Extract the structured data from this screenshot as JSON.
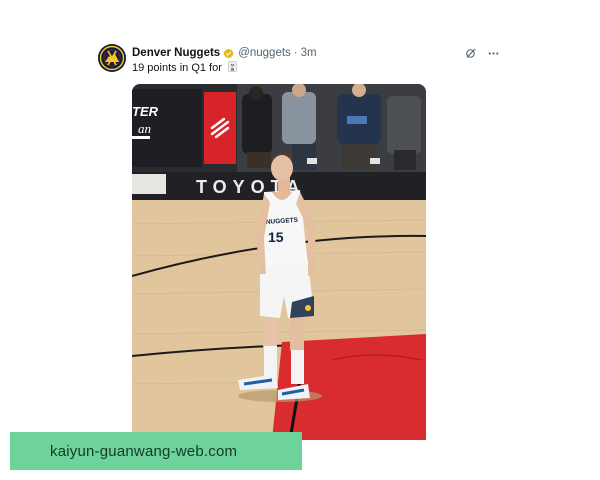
{
  "tweet": {
    "author_name": "Denver Nuggets",
    "handle": "@nuggets",
    "separator": "·",
    "time": "3m",
    "text": "19 points in Q1 for",
    "text_emoji_icon": "joker-card-emoji",
    "verified_icon": "gold-verified-badge-icon",
    "avatar_icon": "denver-nuggets-logo",
    "actions": {
      "grok_icon": "grok-icon",
      "more_icon": "more-dots-icon"
    },
    "media": {
      "court_text": "TOYOTA",
      "board_text": "TER",
      "board_text2": "an",
      "jersey_text": "NUGGETS",
      "jersey_number": "15"
    }
  },
  "banner": {
    "text": "kaiyun-guanwang-web.com"
  },
  "colors": {
    "nuggets_navy": "#0e2240",
    "nuggets_gold": "#fec524",
    "blazers_red": "#e03a3e",
    "banner_green": "#6dd39b"
  }
}
